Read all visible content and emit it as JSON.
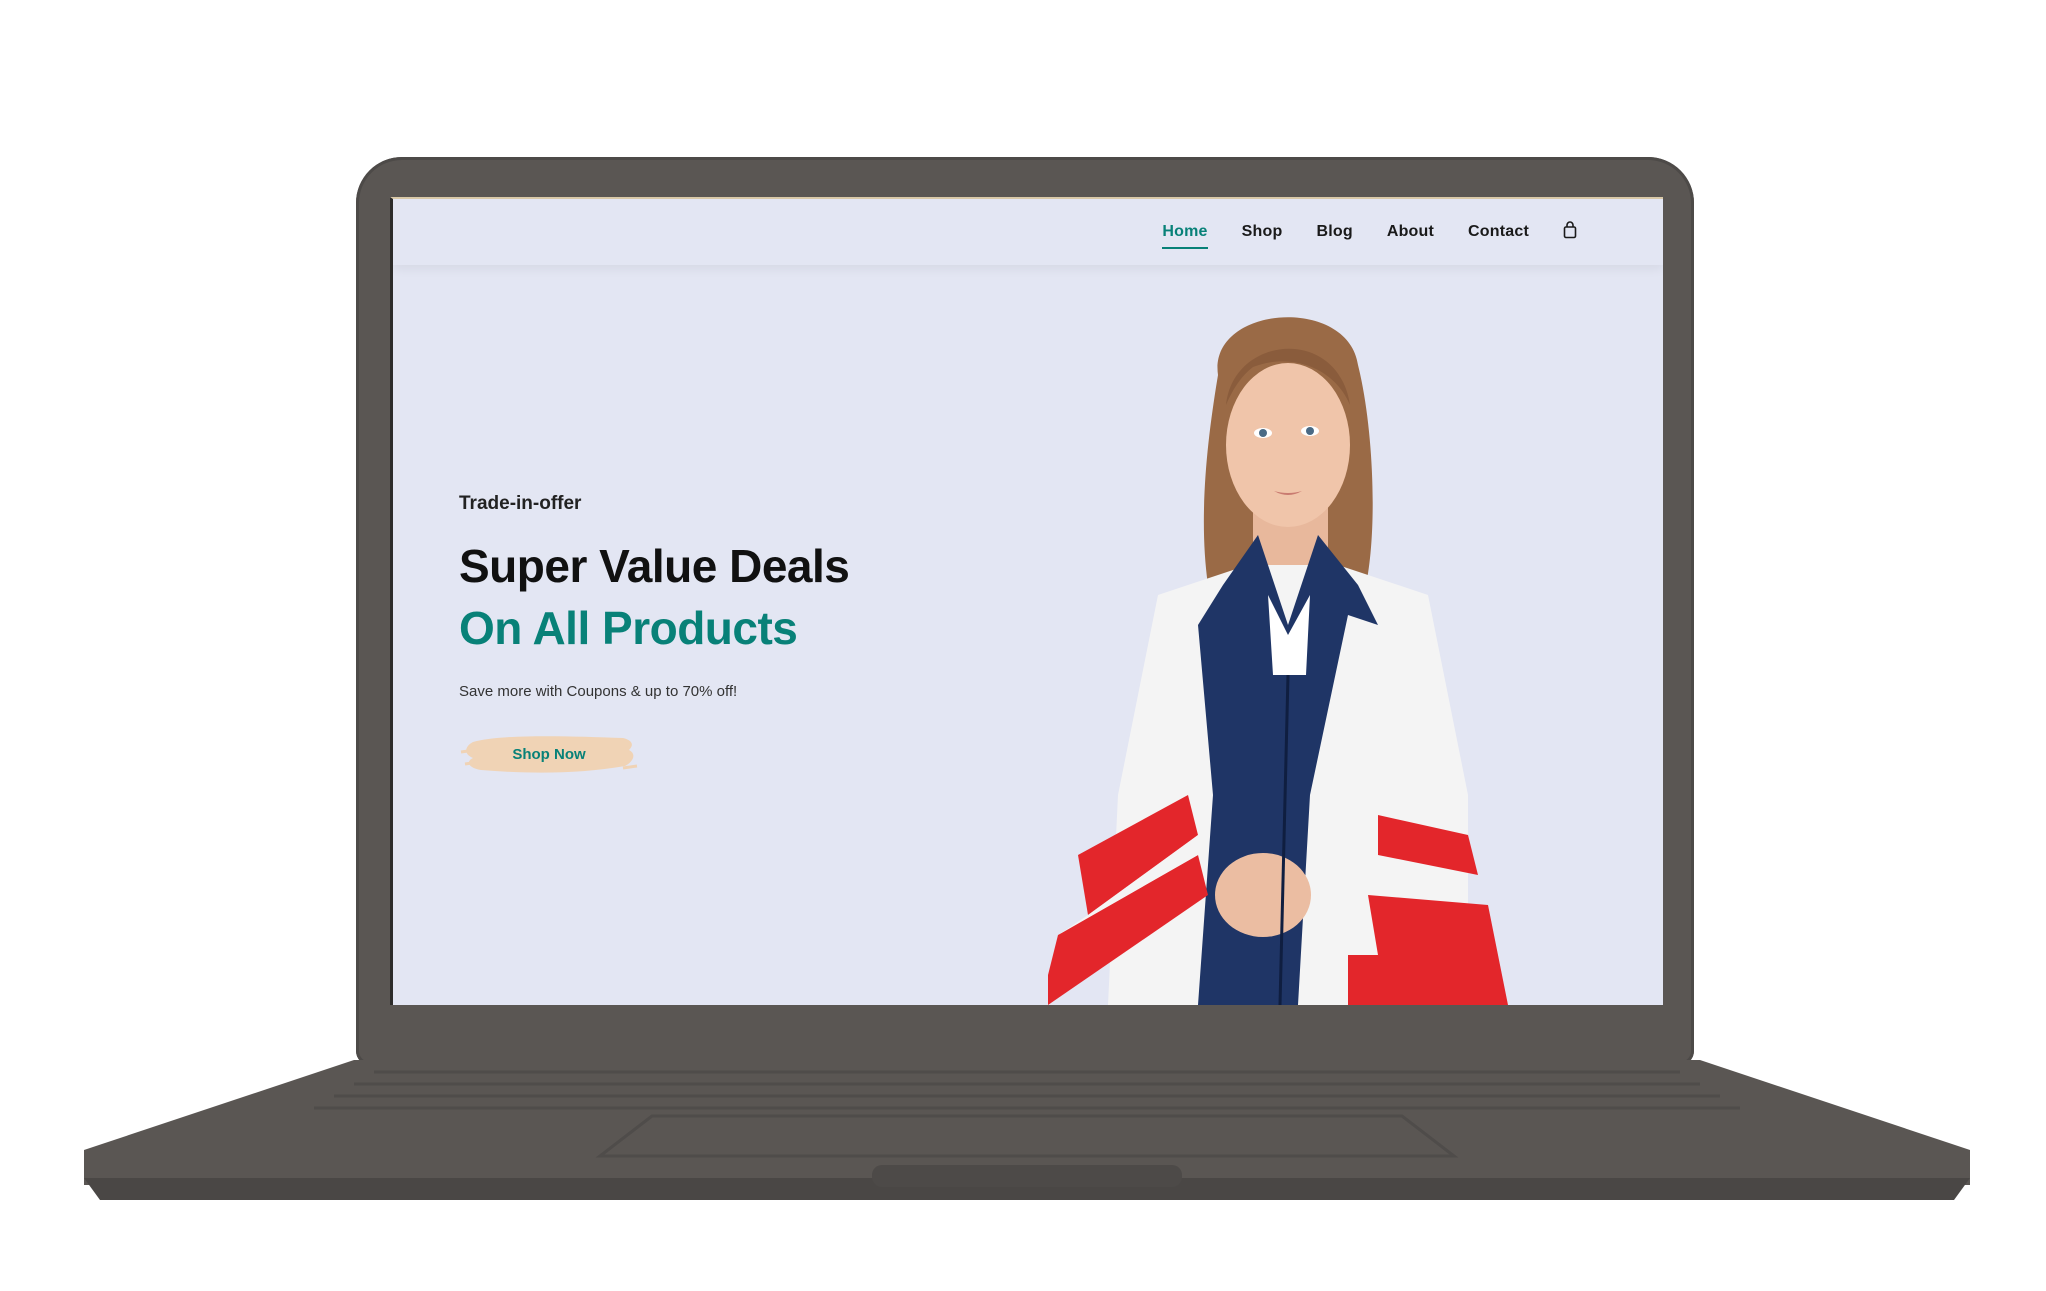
{
  "nav": {
    "items": [
      {
        "label": "Home",
        "active": true
      },
      {
        "label": "Shop",
        "active": false
      },
      {
        "label": "Blog",
        "active": false
      },
      {
        "label": "About",
        "active": false
      },
      {
        "label": "Contact",
        "active": false
      }
    ],
    "cart_icon": "shopping-bag-icon"
  },
  "hero": {
    "offer": "Trade-in-offer",
    "headline": "Super Value Deals",
    "headline_accent": "On All Products",
    "subtext": "Save more with Coupons & up to 70% off!",
    "button_label": "Shop Now"
  },
  "colors": {
    "accent": "#088178",
    "page_bg": "#e3e6f3",
    "button_brush": "#f0d3b5",
    "laptop_body": "#5a5653"
  }
}
